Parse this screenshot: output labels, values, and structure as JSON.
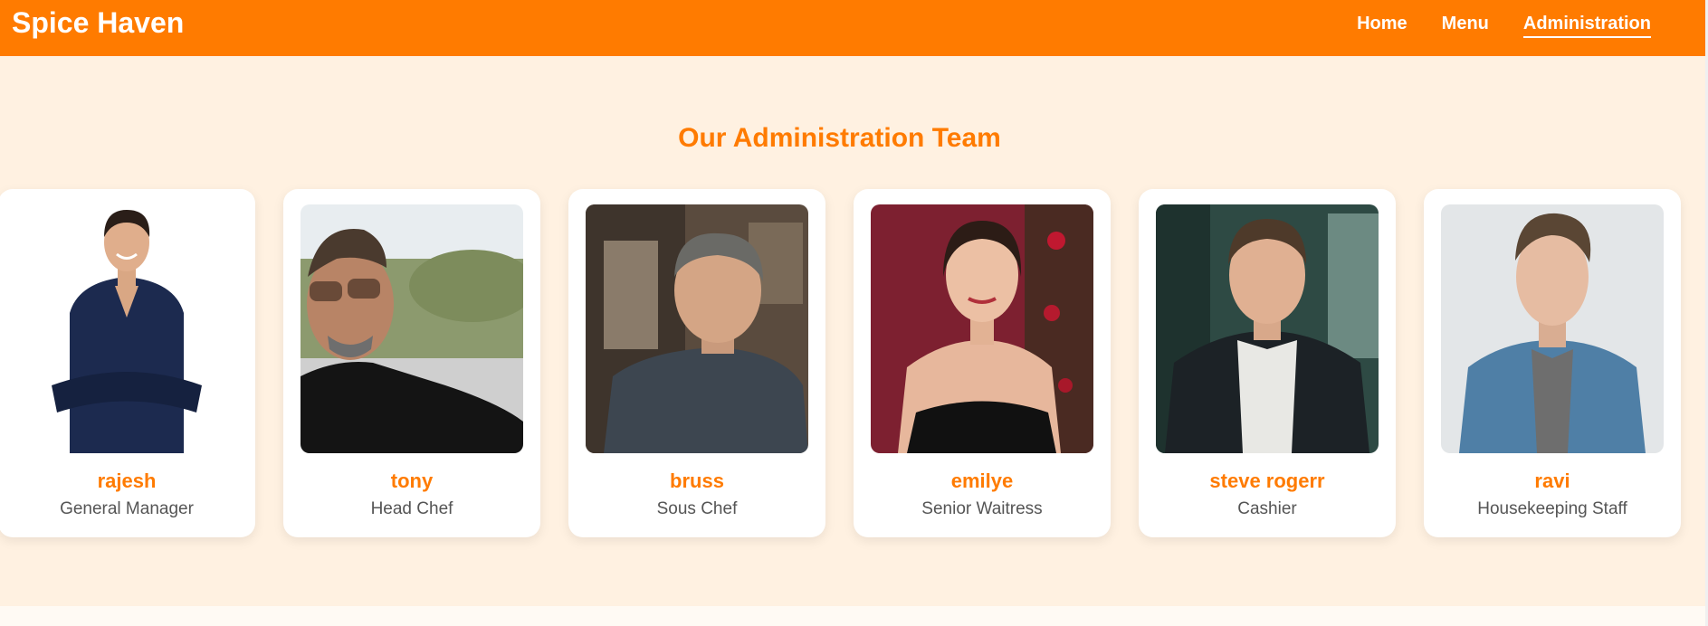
{
  "header": {
    "brand": "Spice Haven",
    "nav": [
      {
        "label": "Home",
        "active": false
      },
      {
        "label": "Menu",
        "active": false
      },
      {
        "label": "Administration",
        "active": true
      }
    ]
  },
  "section": {
    "title": "Our Administration Team"
  },
  "team": [
    {
      "name": "rajesh",
      "role": "General Manager",
      "photo_icon": "man-crossed-arms-photo"
    },
    {
      "name": "tony",
      "role": "Head Chef",
      "photo_icon": "man-sunglasses-photo"
    },
    {
      "name": "bruss",
      "role": "Sous Chef",
      "photo_icon": "man-grey-shirt-photo"
    },
    {
      "name": "emilye",
      "role": "Senior Waitress",
      "photo_icon": "woman-black-dress-photo"
    },
    {
      "name": "steve rogerr",
      "role": "Cashier",
      "photo_icon": "man-dark-jacket-photo"
    },
    {
      "name": "ravi",
      "role": "Housekeeping Staff",
      "photo_icon": "man-denim-jacket-photo"
    }
  ],
  "colors": {
    "accent": "#ff7b00",
    "section_bg": "#fff1e1",
    "card_bg": "#ffffff",
    "role_text": "#555555"
  }
}
